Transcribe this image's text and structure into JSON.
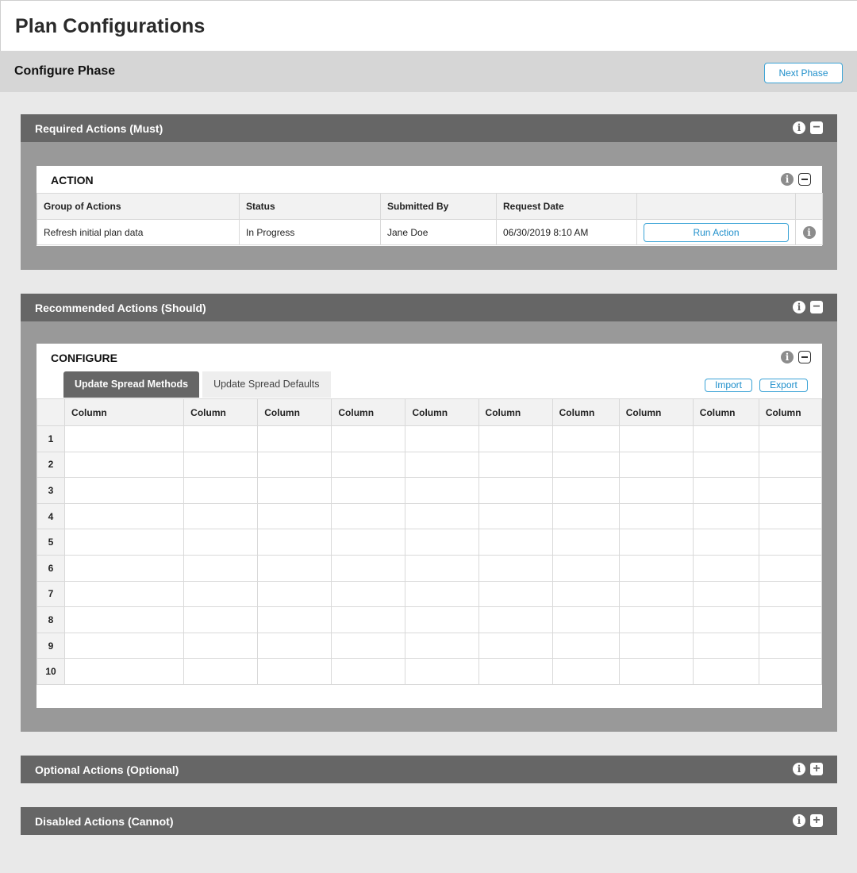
{
  "page": {
    "title": "Plan Configurations"
  },
  "phase": {
    "title": "Configure Phase",
    "next_label": "Next Phase"
  },
  "icons": {
    "info": "info-icon",
    "collapse": "collapse-icon",
    "expand": "expand-icon"
  },
  "colors": {
    "accent": "#1f8fcb",
    "section_bar": "#666666",
    "section_body": "#999999",
    "background": "#e9e9e9"
  },
  "sections": {
    "required": {
      "title": "Required Actions (Must)",
      "card": {
        "title": "ACTION",
        "columns": [
          "Group of Actions",
          "Status",
          "Submitted By",
          "Request Date"
        ],
        "rows": [
          {
            "group": "Refresh initial plan data",
            "status": "In Progress",
            "submitted_by": "Jane Doe",
            "request_date": "06/30/2019 8:10 AM",
            "action_label": "Run Action"
          }
        ]
      }
    },
    "recommended": {
      "title": "Recommended Actions (Should)",
      "card": {
        "title": "CONFIGURE",
        "tabs": [
          "Update Spread Methods",
          "Update Spread Defaults"
        ],
        "import_label": "Import",
        "export_label": "Export",
        "columns": [
          "Column",
          "Column",
          "Column",
          "Column",
          "Column",
          "Column",
          "Column",
          "Column",
          "Column",
          "Column"
        ],
        "row_numbers": [
          "1",
          "2",
          "3",
          "4",
          "5",
          "6",
          "7",
          "8",
          "9",
          "10"
        ]
      }
    },
    "optional": {
      "title": "Optional Actions (Optional)"
    },
    "disabled": {
      "title": "Disabled Actions (Cannot)"
    }
  }
}
